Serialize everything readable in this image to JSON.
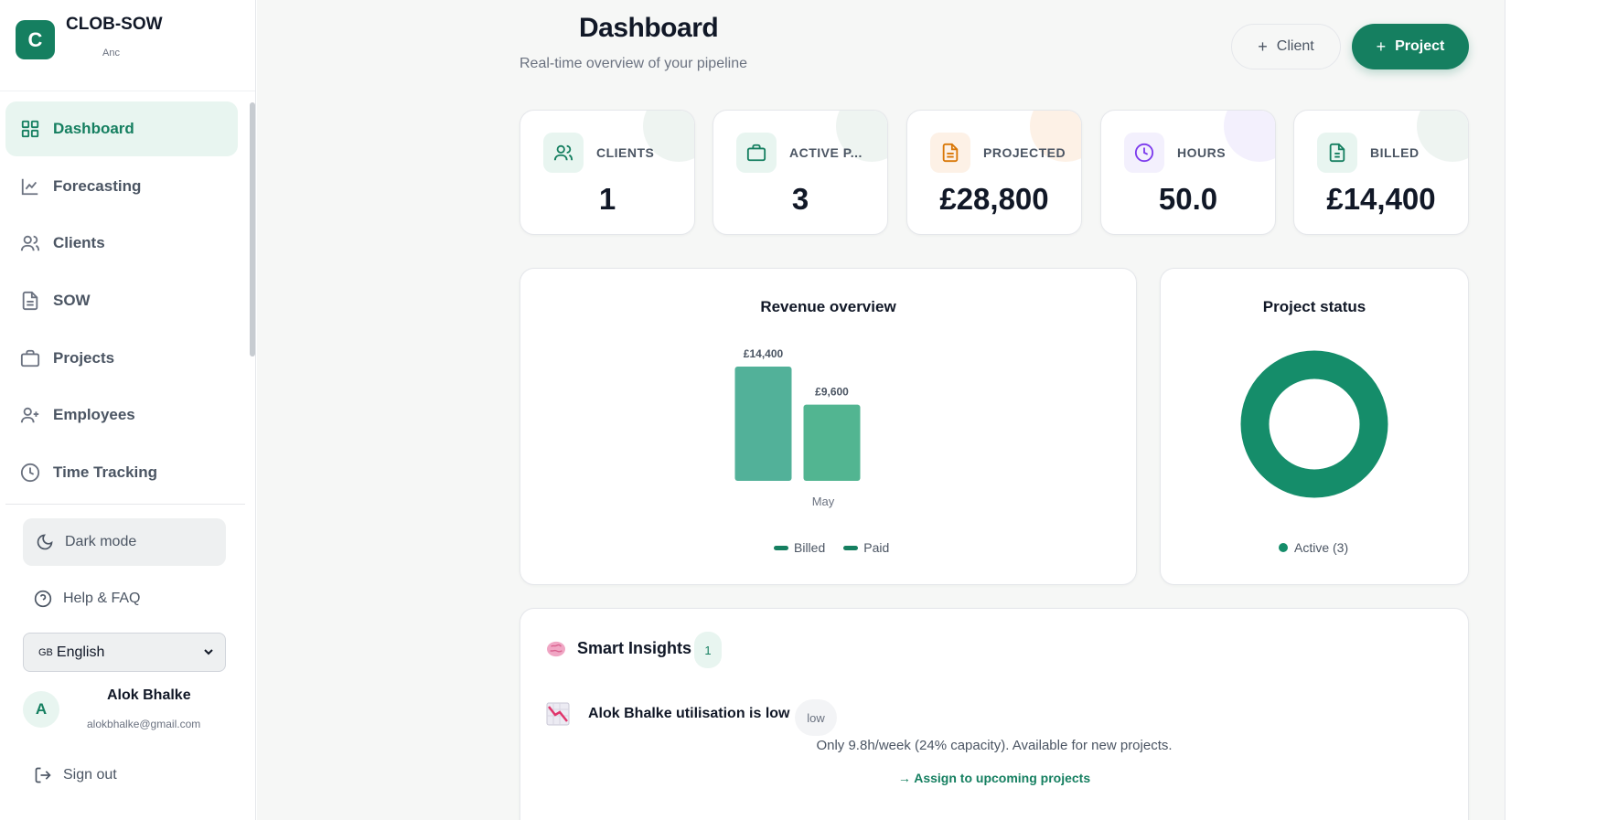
{
  "brand": {
    "logo_letter": "C",
    "title": "CLOB-SOW",
    "subtitle": "Anc"
  },
  "sidebar": {
    "items": [
      {
        "label": "Dashboard",
        "icon": "grid-icon",
        "active": true
      },
      {
        "label": "Forecasting",
        "icon": "trend-chart-icon"
      },
      {
        "label": "Clients",
        "icon": "users-icon"
      },
      {
        "label": "SOW",
        "icon": "document-icon"
      },
      {
        "label": "Projects",
        "icon": "briefcase-icon"
      },
      {
        "label": "Employees",
        "icon": "user-plus-icon"
      },
      {
        "label": "Time Tracking",
        "icon": "clock-icon"
      }
    ],
    "dark_mode": "Dark mode",
    "help": "Help & FAQ",
    "language": {
      "flag": "GB",
      "label": "English"
    },
    "user": {
      "initial": "A",
      "name": "Alok Bhalke",
      "email": "alokbhalke@gmail.com"
    },
    "sign_out": "Sign out"
  },
  "header": {
    "title": "Dashboard",
    "subtitle": "Real-time overview of your pipeline",
    "client_button": "Client",
    "project_button": "Project"
  },
  "stats": [
    {
      "label": "CLIENTS",
      "value": "1",
      "icon": "users-icon",
      "color": "#157f60"
    },
    {
      "label": "ACTIVE P...",
      "value": "3",
      "icon": "briefcase-icon",
      "color": "#157f60"
    },
    {
      "label": "PROJECTED",
      "value": "£28,800",
      "icon": "document-icon",
      "color": "#d97706"
    },
    {
      "label": "HOURS",
      "value": "50.0",
      "icon": "clock-icon",
      "color": "#7c3aed"
    },
    {
      "label": "BILLED",
      "value": "£14,400",
      "icon": "invoice-icon",
      "color": "#157f60"
    }
  ],
  "revenue": {
    "title": "Revenue overview",
    "chart_data": {
      "type": "bar",
      "title": "Revenue overview",
      "categories": [
        "May"
      ],
      "series": [
        {
          "name": "Billed",
          "values": [
            14400
          ],
          "labels": [
            "£14,400"
          ],
          "color": "#52b199"
        },
        {
          "name": "Paid",
          "values": [
            9600
          ],
          "labels": [
            "£9,600"
          ],
          "color": "#52b591"
        }
      ],
      "ylim": [
        0,
        14400
      ],
      "legend": "bottom"
    },
    "legend": [
      "Billed",
      "Paid"
    ]
  },
  "project_status": {
    "title": "Project status",
    "chart_data": {
      "type": "pie",
      "title": "Project status",
      "categories": [
        "Active"
      ],
      "values": [
        3
      ],
      "colors": [
        "#158d6a"
      ],
      "legend": "bottom"
    },
    "legend_label": "Active (3)"
  },
  "insights": {
    "title": "Smart Insights",
    "count": "1",
    "item": {
      "title": "Alok Bhalke utilisation is low",
      "badge": "low",
      "description": "Only 9.8h/week (24% capacity). Available for new projects.",
      "action": "→ Assign to upcoming projects"
    }
  },
  "colors": {
    "brand": "#157f60",
    "background": "#f6f7f6"
  }
}
